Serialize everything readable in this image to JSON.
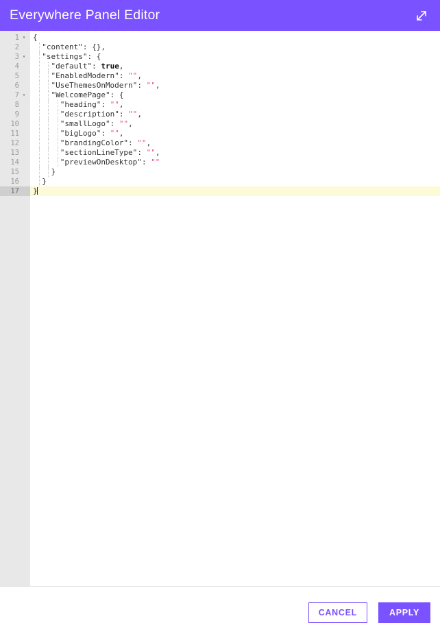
{
  "header": {
    "title": "Everywhere Panel Editor",
    "expand_icon": "expand-arrows-icon",
    "background_color": "#7b52ff",
    "title_color": "#ffffff"
  },
  "editor": {
    "language": "json",
    "total_lines": 17,
    "active_line": 17,
    "active_line_color": "#fcfbd8",
    "gutter_color": "#e8e8e8",
    "string_color": "#e8527f",
    "fold_arrow_lines": [
      1,
      3,
      7
    ],
    "lines": [
      {
        "number": "1",
        "indent": 0,
        "fold": "▾",
        "tokens": [
          {
            "t": "punct",
            "v": "{"
          }
        ]
      },
      {
        "number": "2",
        "indent": 1,
        "fold": "",
        "tokens": [
          {
            "t": "key",
            "v": "\"content\""
          },
          {
            "t": "punct",
            "v": ": "
          },
          {
            "t": "punct",
            "v": "{},"
          }
        ]
      },
      {
        "number": "3",
        "indent": 1,
        "fold": "▾",
        "tokens": [
          {
            "t": "key",
            "v": "\"settings\""
          },
          {
            "t": "punct",
            "v": ": "
          },
          {
            "t": "punct",
            "v": "{"
          }
        ]
      },
      {
        "number": "4",
        "indent": 2,
        "fold": "",
        "tokens": [
          {
            "t": "key",
            "v": "\"default\""
          },
          {
            "t": "punct",
            "v": ": "
          },
          {
            "t": "bool",
            "v": "true"
          },
          {
            "t": "punct",
            "v": ","
          }
        ]
      },
      {
        "number": "5",
        "indent": 2,
        "fold": "",
        "tokens": [
          {
            "t": "key",
            "v": "\"EnabledModern\""
          },
          {
            "t": "punct",
            "v": ": "
          },
          {
            "t": "str",
            "v": "\"\""
          },
          {
            "t": "punct",
            "v": ","
          }
        ]
      },
      {
        "number": "6",
        "indent": 2,
        "fold": "",
        "tokens": [
          {
            "t": "key",
            "v": "\"UseThemesOnModern\""
          },
          {
            "t": "punct",
            "v": ": "
          },
          {
            "t": "str",
            "v": "\"\""
          },
          {
            "t": "punct",
            "v": ","
          }
        ]
      },
      {
        "number": "7",
        "indent": 2,
        "fold": "▾",
        "tokens": [
          {
            "t": "key",
            "v": "\"WelcomePage\""
          },
          {
            "t": "punct",
            "v": ": "
          },
          {
            "t": "punct",
            "v": "{"
          }
        ]
      },
      {
        "number": "8",
        "indent": 3,
        "fold": "",
        "tokens": [
          {
            "t": "key",
            "v": "\"heading\""
          },
          {
            "t": "punct",
            "v": ": "
          },
          {
            "t": "str",
            "v": "\"\""
          },
          {
            "t": "punct",
            "v": ","
          }
        ]
      },
      {
        "number": "9",
        "indent": 3,
        "fold": "",
        "tokens": [
          {
            "t": "key",
            "v": "\"description\""
          },
          {
            "t": "punct",
            "v": ": "
          },
          {
            "t": "str",
            "v": "\"\""
          },
          {
            "t": "punct",
            "v": ","
          }
        ]
      },
      {
        "number": "10",
        "indent": 3,
        "fold": "",
        "tokens": [
          {
            "t": "key",
            "v": "\"smallLogo\""
          },
          {
            "t": "punct",
            "v": ": "
          },
          {
            "t": "str",
            "v": "\"\""
          },
          {
            "t": "punct",
            "v": ","
          }
        ]
      },
      {
        "number": "11",
        "indent": 3,
        "fold": "",
        "tokens": [
          {
            "t": "key",
            "v": "\"bigLogo\""
          },
          {
            "t": "punct",
            "v": ": "
          },
          {
            "t": "str",
            "v": "\"\""
          },
          {
            "t": "punct",
            "v": ","
          }
        ]
      },
      {
        "number": "12",
        "indent": 3,
        "fold": "",
        "tokens": [
          {
            "t": "key",
            "v": "\"brandingColor\""
          },
          {
            "t": "punct",
            "v": ": "
          },
          {
            "t": "str",
            "v": "\"\""
          },
          {
            "t": "punct",
            "v": ","
          }
        ]
      },
      {
        "number": "13",
        "indent": 3,
        "fold": "",
        "tokens": [
          {
            "t": "key",
            "v": "\"sectionLineType\""
          },
          {
            "t": "punct",
            "v": ": "
          },
          {
            "t": "str",
            "v": "\"\""
          },
          {
            "t": "punct",
            "v": ","
          }
        ]
      },
      {
        "number": "14",
        "indent": 3,
        "fold": "",
        "tokens": [
          {
            "t": "key",
            "v": "\"previewOnDesktop\""
          },
          {
            "t": "punct",
            "v": ": "
          },
          {
            "t": "str",
            "v": "\"\""
          }
        ]
      },
      {
        "number": "15",
        "indent": 2,
        "fold": "",
        "tokens": [
          {
            "t": "punct",
            "v": "}"
          }
        ]
      },
      {
        "number": "16",
        "indent": 1,
        "fold": "",
        "tokens": [
          {
            "t": "punct",
            "v": "}"
          }
        ]
      },
      {
        "number": "17",
        "indent": 0,
        "fold": "",
        "tokens": [
          {
            "t": "punct",
            "v": "}"
          }
        ],
        "caret": true
      }
    ]
  },
  "footer": {
    "cancel_label": "CANCEL",
    "apply_label": "APPLY",
    "accent_color": "#7b52ff"
  }
}
